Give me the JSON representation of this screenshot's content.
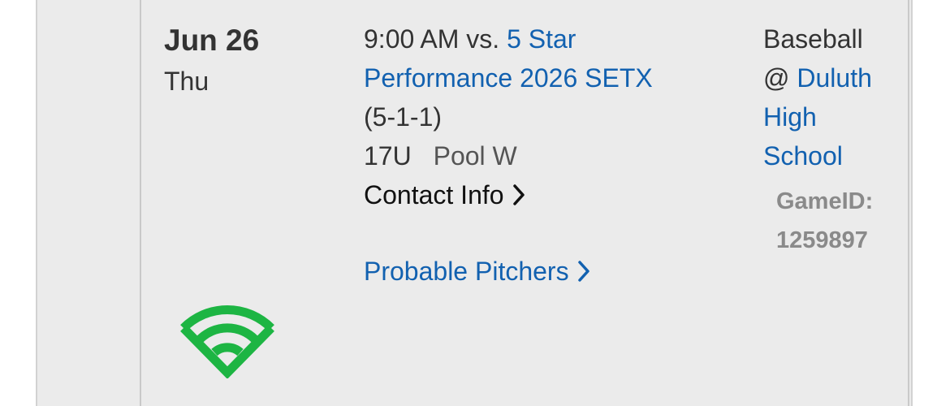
{
  "game": {
    "date": "Jun 26",
    "day_of_week": "Thu",
    "time": "9:00 AM",
    "vs_prefix": "vs.",
    "opponent": "5 Star Performance 2026 SETX",
    "record": "(5-1-1)",
    "age_group": "17U",
    "pool": "Pool W",
    "contact_label": "Contact Info",
    "probable_pitchers_label": "Probable Pitchers",
    "sport": "Baseball",
    "at_prefix": "@",
    "venue": "Duluth High School",
    "game_id_label": "GameID:",
    "game_id": "1259897"
  },
  "colors": {
    "link": "#1261b0",
    "gamechanger_icon": "#1db543",
    "background": "#ebebeb"
  },
  "icons": {
    "chevron": "chevron-right-icon",
    "stream": "gamechanger-stream-icon"
  }
}
